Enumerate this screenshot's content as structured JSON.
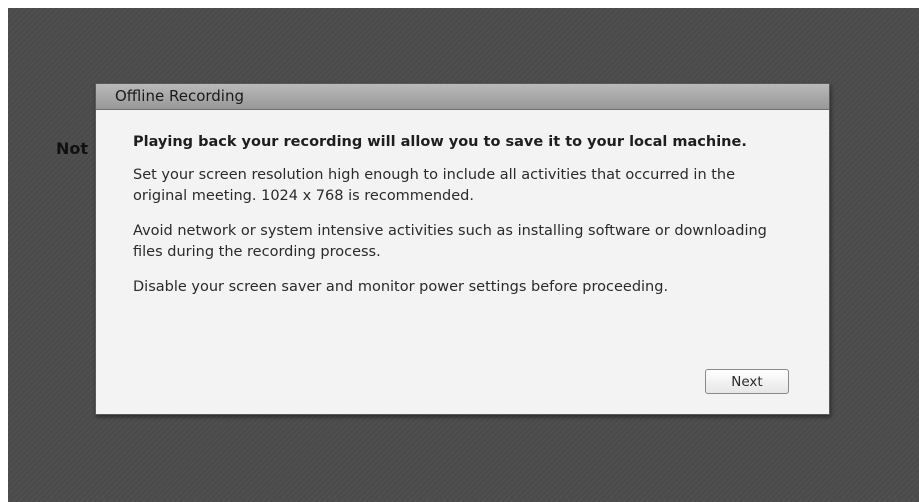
{
  "background": {
    "partial_text": "Not"
  },
  "dialog": {
    "title": "Offline Recording",
    "paragraphs": {
      "p0": "Playing back your recording will allow you to save it to your local machine.",
      "p1": "Set your screen resolution high enough to include all activities that occurred in the original meeting. 1024 x 768 is recommended.",
      "p2": "Avoid network or system intensive activities such as installing software or downloading files during the recording process.",
      "p3": "Disable your screen saver and monitor power settings before proceeding."
    },
    "next_label": "Next"
  },
  "colors": {
    "backdrop": "#4b4b4b",
    "dialog_background": "#f3f3f3",
    "title_bar": "#a8a8a8"
  }
}
